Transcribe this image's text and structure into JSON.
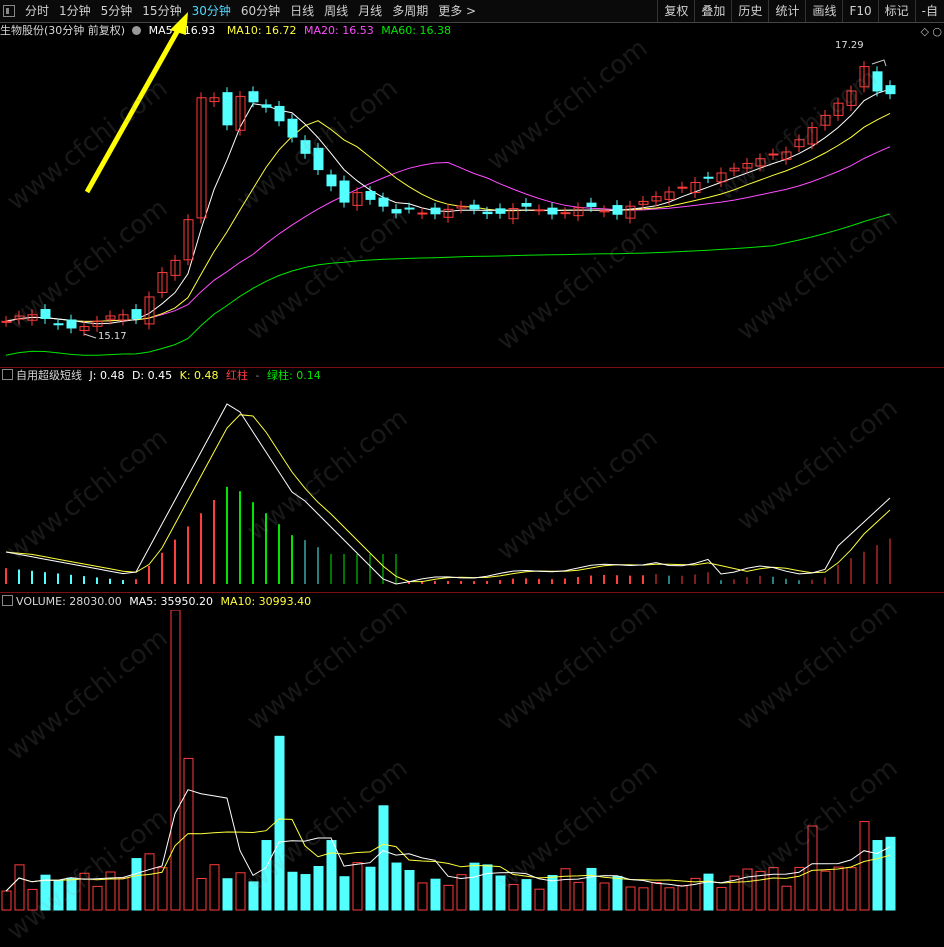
{
  "toolbar": {
    "periods": [
      "分时",
      "1分钟",
      "5分钟",
      "15分钟",
      "30分钟",
      "60分钟",
      "日线",
      "周线",
      "月线",
      "多周期",
      "更多"
    ],
    "active": "30分钟",
    "more_arrow": ">",
    "right_buttons": [
      "复权",
      "叠加",
      "历史",
      "统计",
      "画线",
      "F10",
      "标记",
      "-自"
    ]
  },
  "main_panel": {
    "title": "生物股份(30分钟 前复权)",
    "ma5_label": "MA5:",
    "ma5_value": "16.93",
    "ma10": "MA10: 16.72",
    "ma20": "MA20: 16.53",
    "ma60": "MA60: 16.38",
    "high_label": "17.29",
    "low_label": "15.17",
    "edge_icons": "◇ ○"
  },
  "indicator_panel": {
    "name": "自用超级短线",
    "j": "J: 0.48",
    "d": "D: 0.45",
    "k": "K: 0.48",
    "red": "红柱",
    "dash": "-",
    "green": "绿柱: 0.14"
  },
  "volume_panel": {
    "label": "VOLUME: 28030.00",
    "ma5": "MA5: 35950.20",
    "ma10": "MA10: 30993.40"
  },
  "watermark": "www.cfchi.com",
  "colors": {
    "up": "#ff3c3c",
    "down": "#54ffff",
    "ma5": "#ffffff",
    "ma10": "#ffff3c",
    "ma20": "#ff4cff",
    "ma60": "#00e600",
    "active_tab": "#4fd8ff",
    "annotation_arrow": "#ffff00"
  }
}
